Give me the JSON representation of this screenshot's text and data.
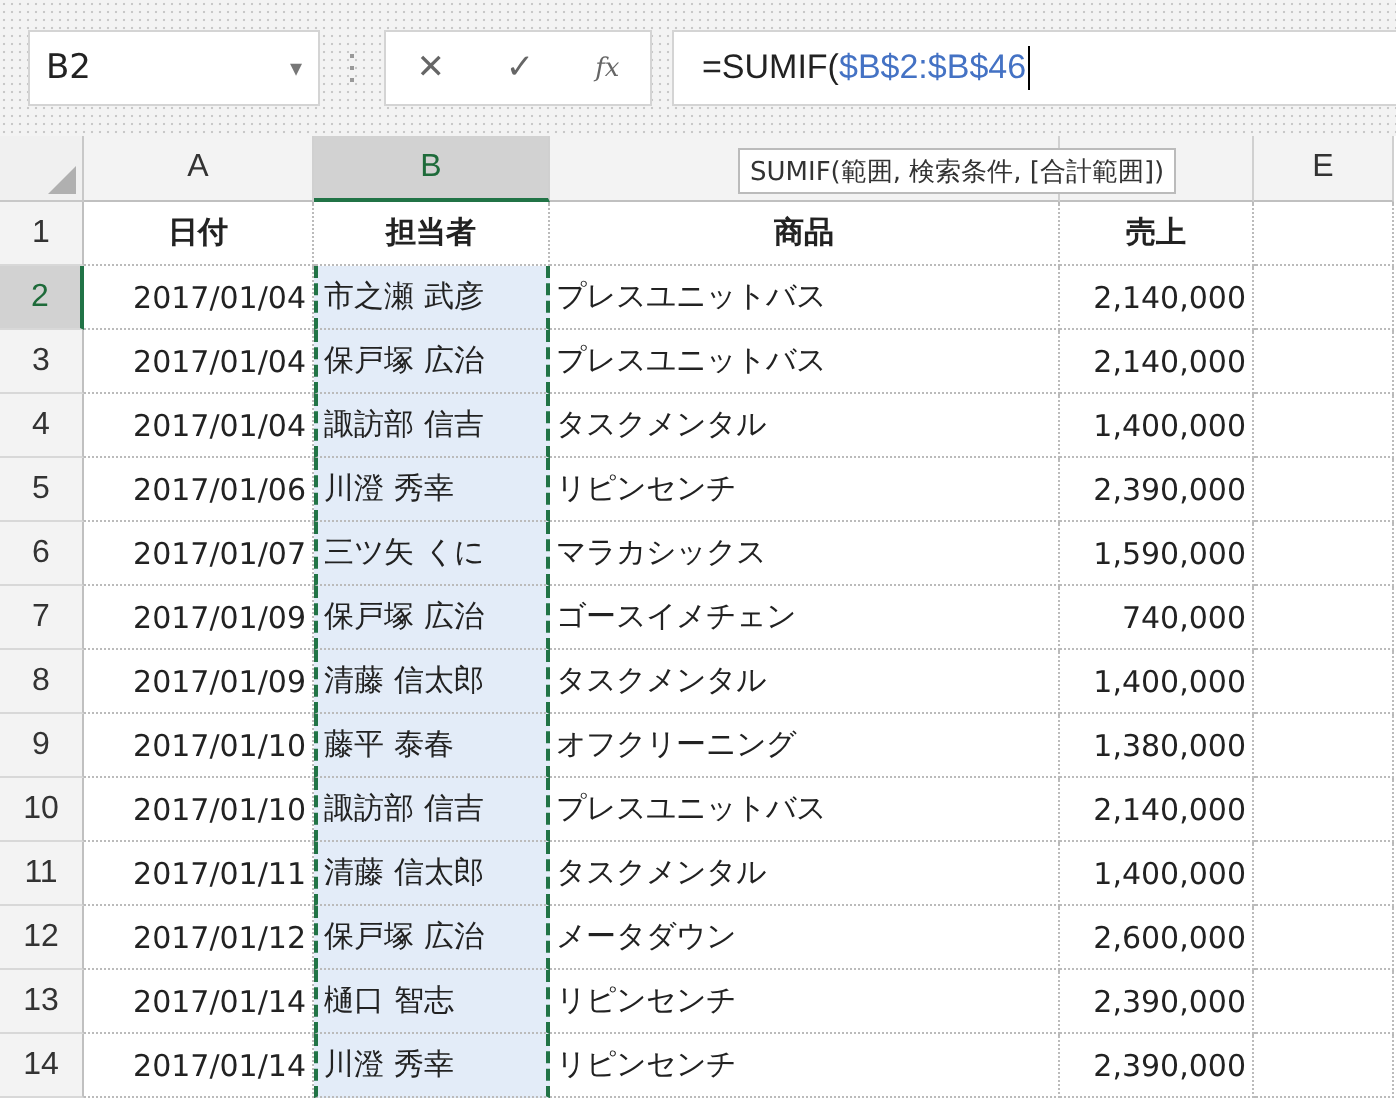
{
  "name_box": {
    "value": "B2",
    "dropdown": "▾"
  },
  "formula_buttons": [
    "✕",
    "✓",
    "fx"
  ],
  "formula": {
    "prefix": "=SUMIF(",
    "reference": "$B$2:$B$46"
  },
  "tooltip": "SUMIF(範囲, 検索条件, [合計範囲])",
  "columns": [
    {
      "label": "A",
      "selected": false,
      "referenced": false
    },
    {
      "label": "B",
      "selected": true,
      "referenced": true
    },
    {
      "selected": false,
      "referenced": false
    },
    {
      "selected": false,
      "referenced": false
    },
    {
      "label": "E",
      "selected": false,
      "referenced": false
    }
  ],
  "rows": [
    {
      "number": "1",
      "selected": false,
      "header": true,
      "cells": [
        "日付",
        "担当者",
        "商品",
        "売上"
      ]
    },
    {
      "number": "2",
      "selected": true,
      "header": false,
      "cells": [
        "2017/01/04",
        "市之瀬 武彦",
        "プレスユニットバス",
        "2,140,000"
      ]
    },
    {
      "number": "3",
      "selected": false,
      "header": false,
      "cells": [
        "2017/01/04",
        "保戸塚 広治",
        "プレスユニットバス",
        "2,140,000"
      ]
    },
    {
      "number": "4",
      "selected": false,
      "header": false,
      "cells": [
        "2017/01/04",
        "諏訪部 信吉",
        "タスクメンタル",
        "1,400,000"
      ]
    },
    {
      "number": "5",
      "selected": false,
      "header": false,
      "cells": [
        "2017/01/06",
        "川澄 秀幸",
        "リピンセンチ",
        "2,390,000"
      ]
    },
    {
      "number": "6",
      "selected": false,
      "header": false,
      "cells": [
        "2017/01/07",
        "三ツ矢 くに",
        "マラカシックス",
        "1,590,000"
      ]
    },
    {
      "number": "7",
      "selected": false,
      "header": false,
      "cells": [
        "2017/01/09",
        "保戸塚 広治",
        "ゴースイメチェン",
        "740,000"
      ]
    },
    {
      "number": "8",
      "selected": false,
      "header": false,
      "cells": [
        "2017/01/09",
        "清藤 信太郎",
        "タスクメンタル",
        "1,400,000"
      ]
    },
    {
      "number": "9",
      "selected": false,
      "header": false,
      "cells": [
        "2017/01/10",
        "藤平 泰春",
        "オフクリーニング",
        "1,380,000"
      ]
    },
    {
      "number": "10",
      "selected": false,
      "header": false,
      "cells": [
        "2017/01/10",
        "諏訪部 信吉",
        "プレスユニットバス",
        "2,140,000"
      ]
    },
    {
      "number": "11",
      "selected": false,
      "header": false,
      "cells": [
        "2017/01/11",
        "清藤 信太郎",
        "タスクメンタル",
        "1,400,000"
      ]
    },
    {
      "number": "12",
      "selected": false,
      "header": false,
      "cells": [
        "2017/01/12",
        "保戸塚 広治",
        "メータダウン",
        "2,600,000"
      ]
    },
    {
      "number": "13",
      "selected": false,
      "header": false,
      "cells": [
        "2017/01/14",
        "樋口 智志",
        "リピンセンチ",
        "2,390,000"
      ]
    },
    {
      "number": "14",
      "selected": false,
      "header": false,
      "cells": [
        "2017/01/14",
        "川澄 秀幸",
        "リピンセンチ",
        "2,390,000"
      ]
    }
  ]
}
